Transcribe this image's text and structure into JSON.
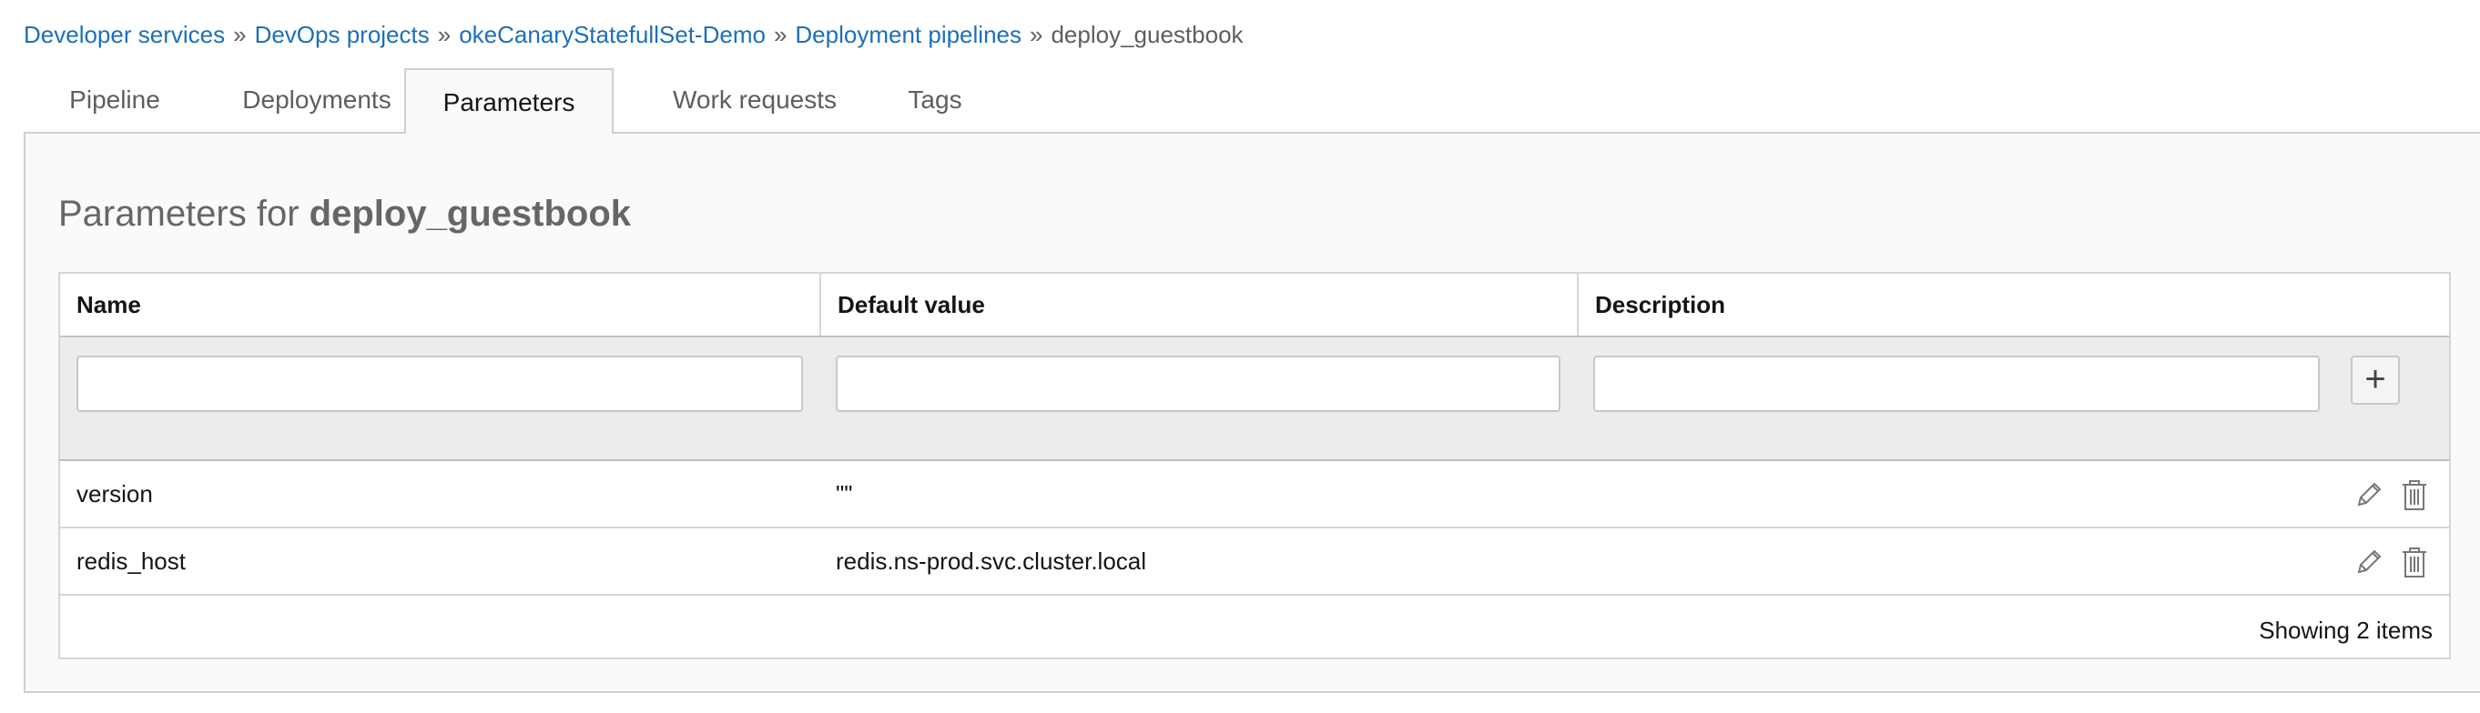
{
  "breadcrumb": {
    "items": [
      "Developer services",
      "DevOps projects",
      "okeCanaryStatefullSet-Demo",
      "Deployment pipelines"
    ],
    "separator": "»",
    "current": "deploy_guestbook"
  },
  "tabs": [
    "Pipeline",
    "Deployments",
    "Parameters",
    "Work requests",
    "Tags"
  ],
  "active_tab": "Parameters",
  "panel": {
    "title_prefix": "Parameters for",
    "title_name": "deploy_guestbook"
  },
  "table": {
    "columns": [
      "Name",
      "Default value",
      "Description"
    ],
    "add_row": {
      "name_value": "",
      "default_value": "",
      "description_value": "",
      "add_button_label": "+"
    },
    "rows": [
      {
        "name": "version",
        "default_value": "\"\"",
        "description": ""
      },
      {
        "name": "redis_host",
        "default_value": "redis.ns-prod.svc.cluster.local",
        "description": ""
      }
    ],
    "footer": "Showing 2 items"
  },
  "icons": {
    "edit": "pencil-icon",
    "delete": "trash-icon"
  },
  "colors": {
    "link": "#1d6fb8",
    "muted_text": "#5e5e5e",
    "panel_bg": "#fafafa",
    "addrow_bg": "#ececec"
  }
}
